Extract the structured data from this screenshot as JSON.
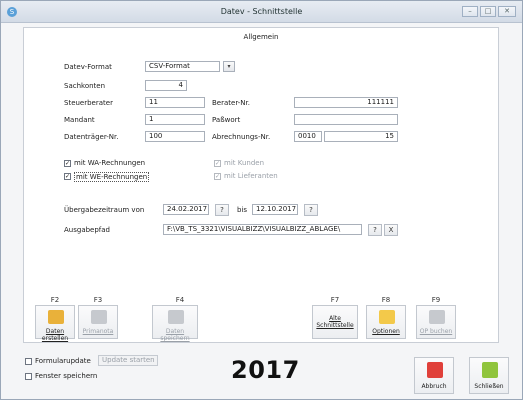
{
  "window": {
    "title": "Datev - Schnittstelle",
    "app_icon": "S",
    "min_icon": "–",
    "max_icon": "□",
    "close_icon": "✕"
  },
  "section": {
    "title": "Allgemein"
  },
  "form": {
    "datev_format_label": "Datev-Format",
    "datev_format_value": "CSV-Format",
    "datev_format_arrow": "▾",
    "sachkonten_label": "Sachkonten",
    "sachkonten_value": "4",
    "steuerberater_label": "Steuerberater",
    "steuerberater_value": "11",
    "berater_nr_label": "Berater-Nr.",
    "berater_nr_value": "111111",
    "mandant_label": "Mandant",
    "mandant_value": "1",
    "passwort_label": "Paßwort",
    "passwort_value": "",
    "datentraeger_label": "Datenträger-Nr.",
    "datentraeger_value": "100",
    "abrechnungs_label": "Abrechnungs-Nr.",
    "abrechnungs_value_1": "0010",
    "abrechnungs_value_2": "15"
  },
  "checks": {
    "wa_label": "mit WA-Rechnungen",
    "we_label": "mit WE-Rechnungen",
    "kunden_label": "mit Kunden",
    "lieferanten_label": "mit Lieferanten",
    "mark": "✓"
  },
  "range": {
    "label": "Übergabezeitraum von",
    "from": "24.02.2017",
    "bis_label": "bis",
    "to": "12.10.2017",
    "help": "?"
  },
  "path": {
    "label": "Ausgabepfad",
    "value": "F:\\VB_TS_3321\\VISUALBIZZ\\VISUALBIZZ_ABLAGE\\",
    "help": "?",
    "clear": "X"
  },
  "toolbar": {
    "f2": "F2",
    "f3": "F3",
    "f4": "F4",
    "f7": "F7",
    "f8": "F8",
    "f9": "F9",
    "daten_erstellen": "Daten erstellen",
    "primanota": "Primanota",
    "daten_speichern": "Daten speichern",
    "alte_line1": "Alte",
    "alte_line2": "Schnittstelle",
    "optionen": "Optionen",
    "op_buchen": "OP buchen"
  },
  "bottom": {
    "formularupdate": "Formularupdate",
    "update_starten": "Update starten",
    "fenster_speichern": "Fenster speichern",
    "year": "2017",
    "abbruch": "Abbruch",
    "schliessen": "Schließen"
  },
  "colors": {
    "folder_icon": "#e9b13a",
    "options_icon": "#f3c94a",
    "abbruch_icon": "#e0403a",
    "schliessen_icon": "#8fc43c"
  }
}
